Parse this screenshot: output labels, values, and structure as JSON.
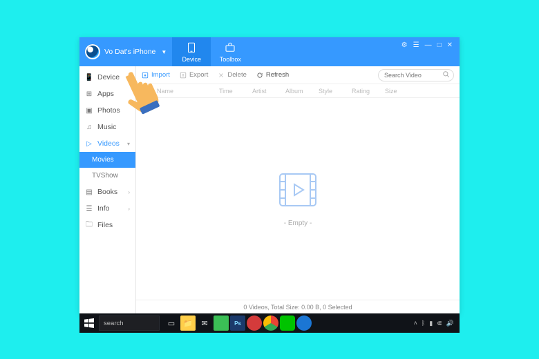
{
  "header": {
    "device_name": "Vo Dat's iPhone",
    "tabs": {
      "device": "Device",
      "toolbox": "Toolbox"
    }
  },
  "sidebar": {
    "items": [
      {
        "label": "Device",
        "icon": "📱"
      },
      {
        "label": "Apps",
        "icon": "⊞"
      },
      {
        "label": "Photos",
        "icon": "▣"
      },
      {
        "label": "Music",
        "icon": "♫"
      },
      {
        "label": "Videos",
        "icon": "▷",
        "active": true
      },
      {
        "label": "Books",
        "icon": "▤"
      },
      {
        "label": "Info",
        "icon": "☰"
      },
      {
        "label": "Files",
        "icon": "🗀"
      }
    ],
    "sub": {
      "movies": "Movies",
      "tvshow": "TVShow"
    }
  },
  "toolbar": {
    "import": "Import",
    "export": "Export",
    "delete": "Delete",
    "refresh": "Refresh",
    "search_placeholder": "Search Video"
  },
  "columns": {
    "name": "Name",
    "time": "Time",
    "artist": "Artist",
    "album": "Album",
    "style": "Style",
    "rating": "Rating",
    "size": "Size"
  },
  "empty_text": "- Empty -",
  "status_text": "0 Videos, Total Size: 0.00 B, 0 Selected",
  "taskbar": {
    "search": "search"
  },
  "colors": {
    "accent": "#3699FF"
  }
}
